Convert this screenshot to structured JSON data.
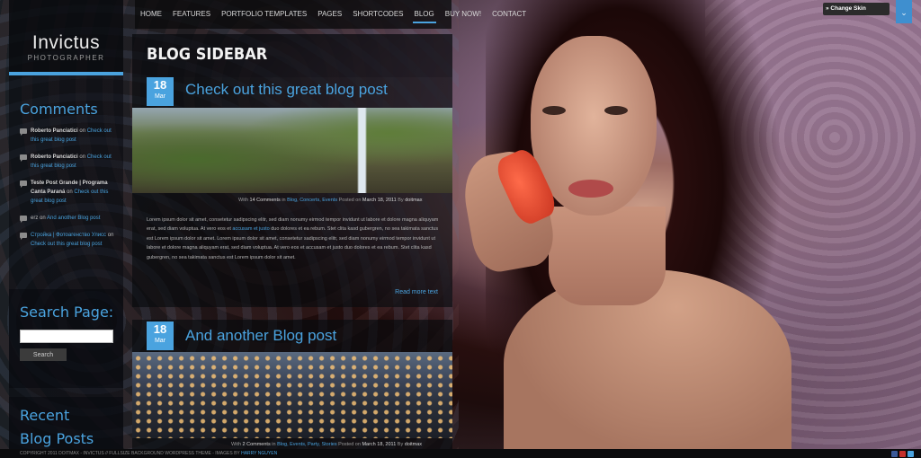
{
  "nav": {
    "items": [
      "HOME",
      "FEATURES",
      "PORTFOLIO TEMPLATES",
      "PAGES",
      "SHORTCODES",
      "BLOG",
      "BUY NOW!",
      "CONTACT"
    ],
    "active_index": 5
  },
  "skin_switcher": {
    "label": "» Change Skin"
  },
  "logo": {
    "title": "Invictus",
    "subtitle": "PHOTOGRAPHER"
  },
  "sidebar": {
    "comments": {
      "title": "Comments",
      "items": [
        {
          "author": "Roberto Panciatici",
          "on": "on",
          "link": "Check out this great blog post"
        },
        {
          "author": "Roberto Panciatici",
          "on": "on",
          "link": "Check out this great blog post"
        },
        {
          "author": "Teste Post Grande | Programa Canta Paraná",
          "on": "on",
          "link": "Check out this great blog post"
        },
        {
          "author": "erz",
          "on": "on",
          "link": "And another Blog post"
        },
        {
          "author": "Стройка | Фотоагенство Улисс",
          "on": "on",
          "link": "Check out this great blog post"
        }
      ]
    },
    "search": {
      "title": "Search Page:",
      "placeholder": "",
      "button": "Search"
    },
    "recent": {
      "title": "Recent Blog Posts"
    }
  },
  "main": {
    "page_title": "BLOG SIDEBAR",
    "posts": [
      {
        "day": "18",
        "month": "Mar",
        "title": "Check out this great blog post",
        "meta": {
          "with": "With",
          "comments": "14 Comments",
          "in": "in",
          "cats": "Blog, Concerts, Events",
          "posted": "Posted on",
          "date": "March 18, 2011",
          "by": "By",
          "author": "doitmax"
        },
        "excerpt_a": "Lorem ipsum dolor sit amet, consetetur sadipscing elitr, sed diam nonumy eirmod tempor invidunt ut labore et dolore magna aliquyam erat, sed diam voluptua. At vero eos et",
        "excerpt_link": "accusam et justo",
        "excerpt_b": "duo dolores et ea rebum. Stet clita kasd gubergren, no sea takimata sanctus est Lorem ipsum dolor sit amet. Lorem ipsum dolor sit amet, consetetur sadipscing elitr, sed diam nonumy eirmod tempor invidunt ut labore et dolore magna aliquyam erat, sed diam voluptua. At vero eos et accusam et justo duo dolores et ea rebum. Stet clita kasd gubergren, no sea takimata sanctus est Lorem ipsum dolor sit amet.",
        "read_more": "Read more text"
      },
      {
        "day": "18",
        "month": "Mar",
        "title": "And another Blog post",
        "meta": {
          "with": "With",
          "comments": "2 Comments",
          "in": "in",
          "cats": "Blog, Events, Party, Stories",
          "posted": "Posted on",
          "date": "March 18, 2011",
          "by": "By",
          "author": "doitmax"
        }
      }
    ]
  },
  "footer": {
    "text": "COPYRIGHT 2011 DOITMAX - INVICTUS // FULLSIZE BACKGROUND WORDPRESS THEME - IMAGES BY",
    "link": "HARRY NGUYEN"
  },
  "colors": {
    "accent": "#4aa3df",
    "panel": "#080a0e"
  }
}
